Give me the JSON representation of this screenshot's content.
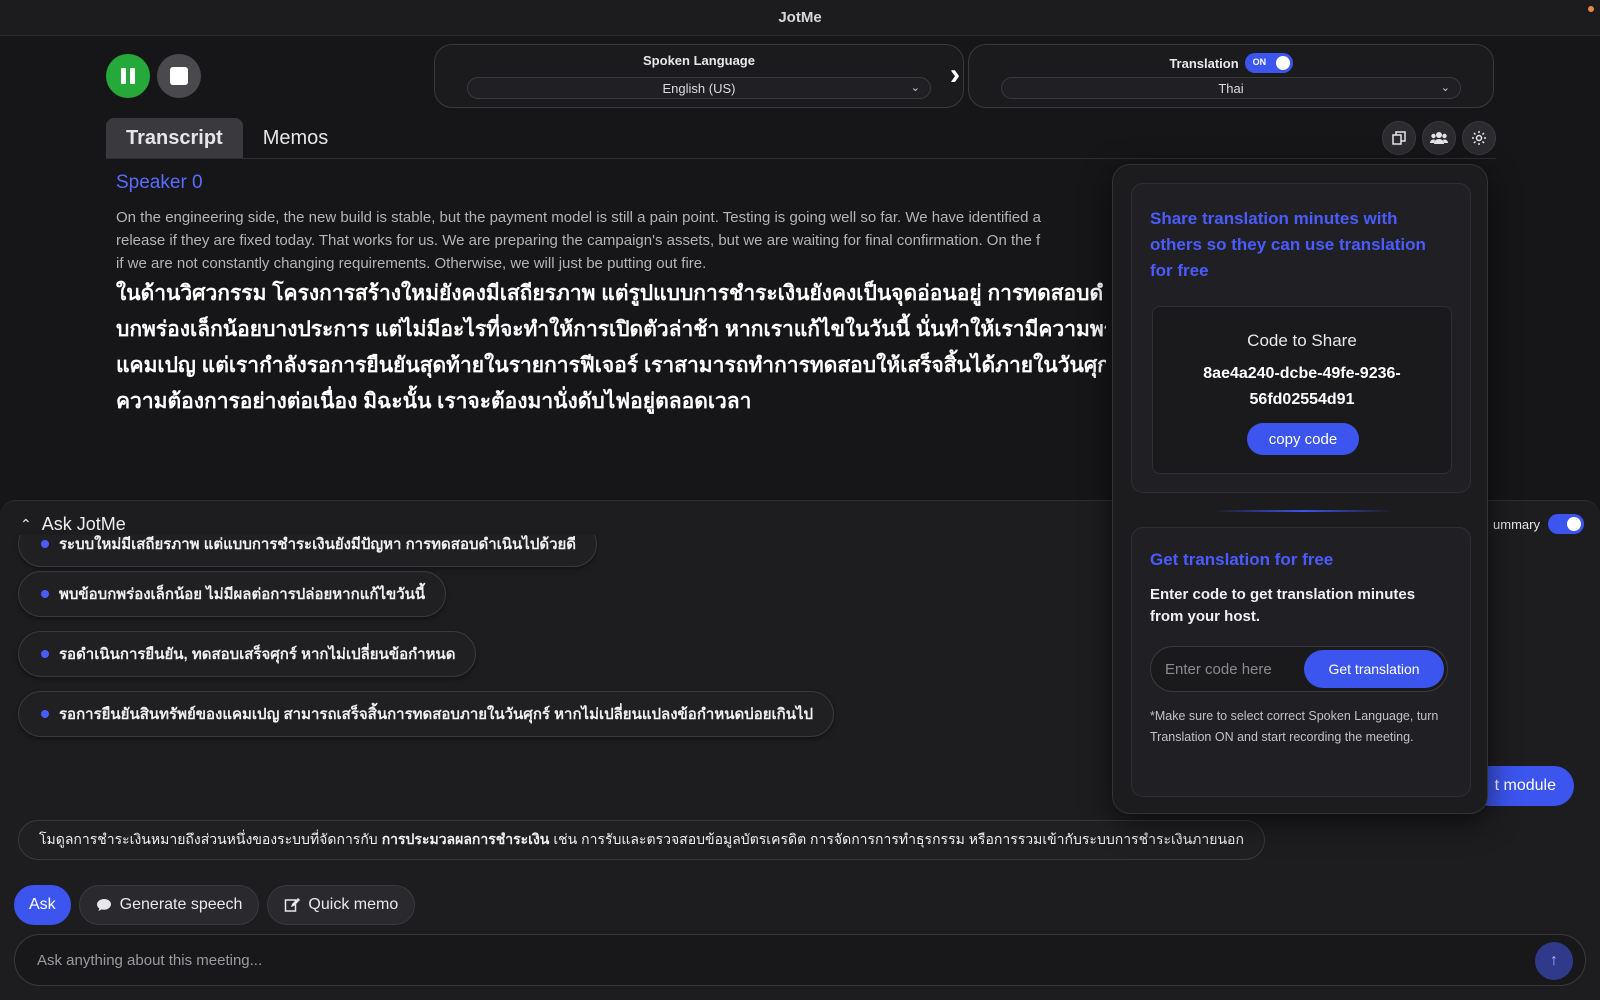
{
  "app": {
    "title": "JotMe"
  },
  "recording": {
    "pause_icon": "pause-icon",
    "stop_icon": "stop-icon",
    "pause_color": "#24a93a"
  },
  "spoken_language": {
    "label": "Spoken Language",
    "selected": "English (US)"
  },
  "translation": {
    "label": "Translation",
    "toggle_text": "ON",
    "enabled": true,
    "selected": "Thai"
  },
  "tabs": [
    {
      "label": "Transcript",
      "active": true
    },
    {
      "label": "Memos",
      "active": false
    }
  ],
  "toolbar_icons": [
    "copy-icon",
    "people-icon",
    "settings-icon"
  ],
  "transcript": {
    "speaker": "Speaker 0",
    "lines_en": [
      "On the engineering side, the new build is stable, but the payment model is still a pain point. Testing is going well so far. We have identified a",
      "release if they are fixed today. That works for us. We are preparing the campaign's assets, but we are waiting for final confirmation. On the f",
      "if we are not constantly changing requirements. Otherwise, we will just be putting out fire."
    ],
    "lines_th": [
      "ในด้านวิศวกรรม โครงการสร้างใหม่ยังคงมีเสถียรภาพ แต่รูปแบบการชำระเงินยังคงเป็นจุดอ่อนอยู่ การทดสอบดํ",
      "บกพร่องเล็กน้อยบางประการ แต่ไม่มีอะไรที่จะทำให้การเปิดตัวล่าช้า หากเราแก้ไขในวันนี้ นั่นทำให้เรามีความพร้",
      "แคมเปญ แต่เรากำลังรอการยืนยันสุดท้ายในรายการฟีเจอร์ เราสามารถทำการทดสอบให้เสร็จสิ้นได้ภายในวันศุก",
      "ความต้องการอย่างต่อเนื่อง มิฉะนั้น เราจะต้องมานั่งดับไฟอยู่ตลอดเวลา"
    ]
  },
  "ask_panel": {
    "title": "Ask JotMe",
    "summary_label": "ummary",
    "summary_enabled": true,
    "bullets": [
      "ระบบใหม่มีเสถียรภาพ แต่แบบการชำระเงินยังมีปัญหา การทดสอบดำเนินไปด้วยดี",
      "พบข้อบกพร่องเล็กน้อย ไม่มีผลต่อการปล่อยหากแก้ไขวันนี้",
      "รอดำเนินการยืนยัน, ทดสอบเสร็จศุกร์ หากไม่เปลี่ยนข้อกำหนด",
      "รอการยืนยันสินทรัพย์ของแคมเปญ สามารถเสร็จสิ้นการทดสอบภายในวันศุกร์ หากไม่เปลี่ยนแปลงข้อกำหนดบ่อยเกินไป"
    ],
    "module_button": "t module",
    "answer_prefix": "โมดูลการชำระเงินหมายถึงส่วนหนึ่งของระบบที่จัดการกับ",
    "answer_bold": "การประมวลผลการชำระเงิน",
    "answer_suffix": "เช่น การรับและตรวจสอบข้อมูลบัตรเครดิต การจัดการการทำธุรกรรม หรือการรวมเข้ากับระบบการชำระเงินภายนอก",
    "actions": {
      "ask": "Ask",
      "generate_speech": "Generate speech",
      "quick_memo": "Quick memo"
    },
    "input_placeholder": "Ask anything about this meeting...",
    "send_icon": "arrow-up-icon"
  },
  "share_popover": {
    "share_title": "Share translation minutes with others so they can use translation for free",
    "code_label": "Code to Share",
    "code_line1": "8ae4a240-dcbe-49fe-9236-",
    "code_line2": "56fd02554d91",
    "copy_button": "copy code",
    "free_title": "Get translation for free",
    "free_desc": "Enter code to get translation minutes from your host.",
    "code_placeholder": "Enter code here",
    "get_button": "Get translation",
    "note": "*Make sure to select correct Spoken Language, turn Translation ON and start recording the meeting."
  },
  "colors": {
    "accent": "#3b55ee",
    "speaker": "#5a6cff",
    "background": "#161618"
  }
}
